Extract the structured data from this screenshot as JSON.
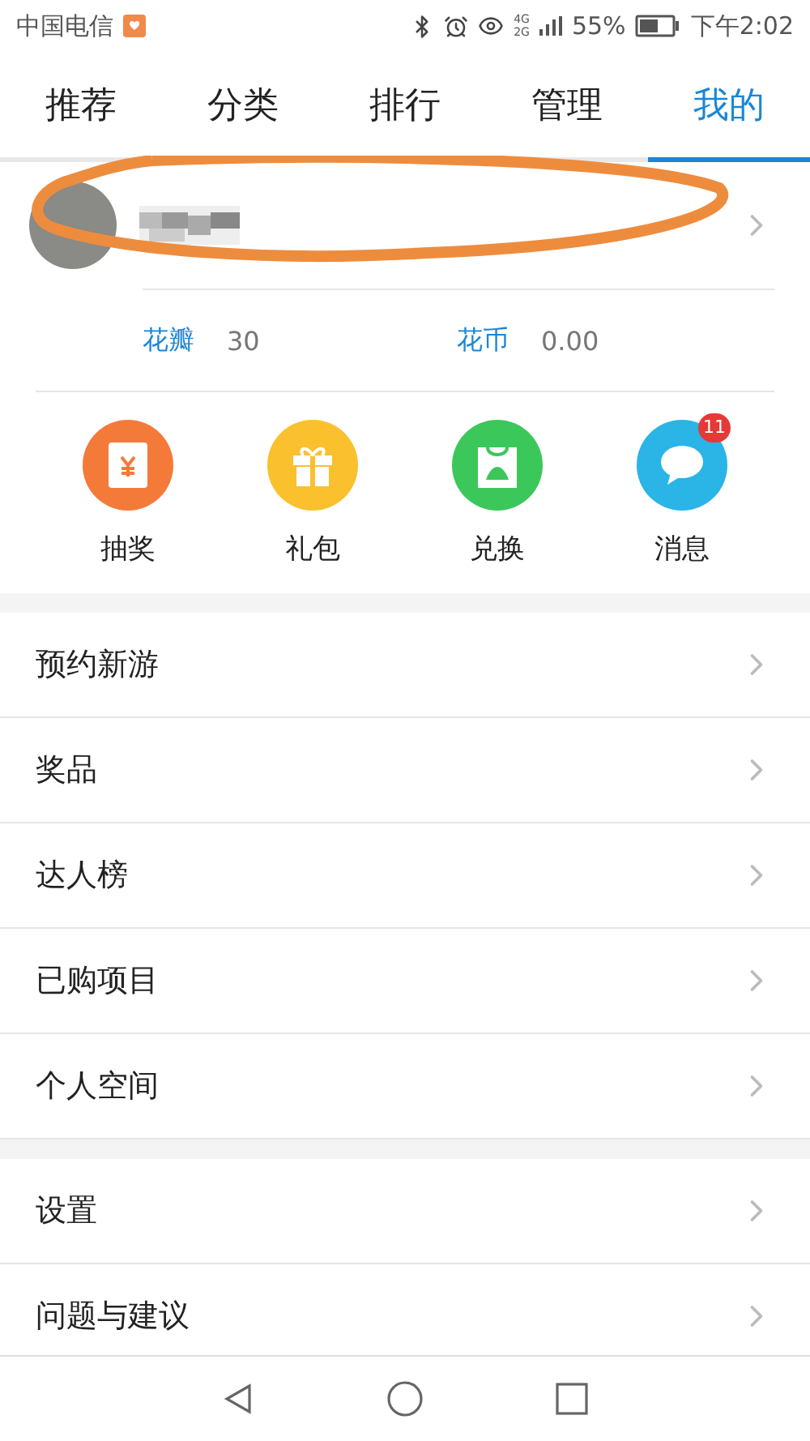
{
  "status_bar": {
    "carrier": "中国电信",
    "network_labels": [
      "4G",
      "2G"
    ],
    "battery_percent": "55%",
    "time": "下午2:02"
  },
  "tabs": [
    {
      "label": "推荐",
      "selected": false
    },
    {
      "label": "分类",
      "selected": false
    },
    {
      "label": "排行",
      "selected": false
    },
    {
      "label": "管理",
      "selected": false
    },
    {
      "label": "我的",
      "selected": true
    }
  ],
  "stats": [
    {
      "label": "花瓣",
      "value": "30"
    },
    {
      "label": "花币",
      "value": "0.00"
    }
  ],
  "shortcuts": [
    {
      "label": "抽奖",
      "kind": "envelope",
      "color": "#f47a3a"
    },
    {
      "label": "礼包",
      "kind": "gift",
      "color": "#fbc02d"
    },
    {
      "label": "兑换",
      "kind": "bag",
      "color": "#3cc75a"
    },
    {
      "label": "消息",
      "kind": "chat",
      "color": "#2bb4e6",
      "badge": "11"
    }
  ],
  "menu_groups": [
    [
      {
        "label": "预约新游"
      },
      {
        "label": "奖品"
      },
      {
        "label": "达人榜"
      },
      {
        "label": "已购项目"
      },
      {
        "label": "个人空间"
      }
    ],
    [
      {
        "label": "设置"
      },
      {
        "label": "问题与建议"
      }
    ]
  ]
}
